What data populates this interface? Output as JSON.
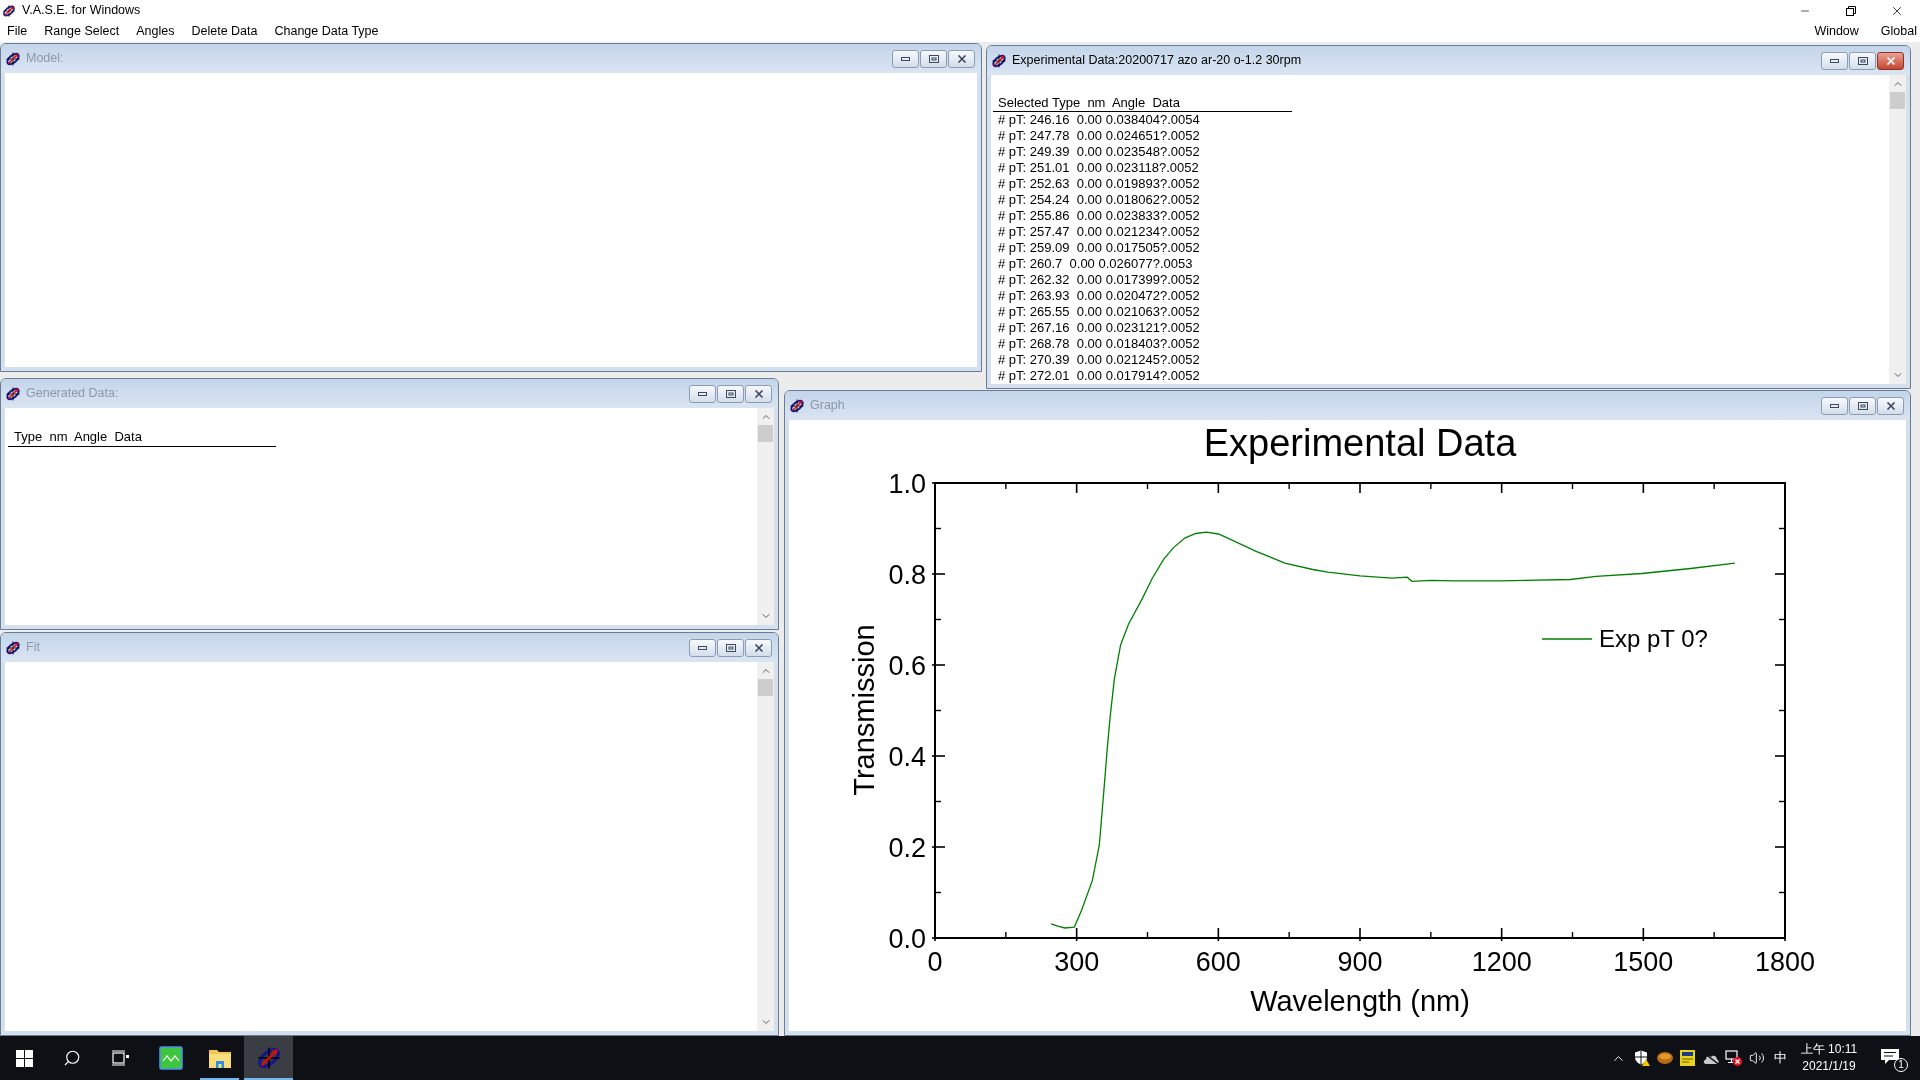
{
  "app": {
    "title": "V.A.S.E. for Windows"
  },
  "menu_bar": {
    "items": [
      "File",
      "Range Select",
      "Angles",
      "Delete Data",
      "Change Data Type"
    ],
    "right_items": [
      "Window",
      "Global"
    ]
  },
  "model_window": {
    "title": "Model:",
    "active": false
  },
  "experimental_data_window": {
    "title": "Experimental Data:20200717 azo ar-20 o-1.2 30rpm",
    "active": true,
    "header": "Selected Type  nm  Angle  Data",
    "rows": [
      "# pT: 246.16  0.00 0.038404?.0054",
      "# pT: 247.78  0.00 0.024651?.0052",
      "# pT: 249.39  0.00 0.023548?.0052",
      "# pT: 251.01  0.00 0.023118?.0052",
      "# pT: 252.63  0.00 0.019893?.0052",
      "# pT: 254.24  0.00 0.018062?.0052",
      "# pT: 255.86  0.00 0.023833?.0052",
      "# pT: 257.47  0.00 0.021234?.0052",
      "# pT: 259.09  0.00 0.017505?.0052",
      "# pT: 260.7  0.00 0.026077?.0053",
      "# pT: 262.32  0.00 0.017399?.0052",
      "# pT: 263.93  0.00 0.020472?.0052",
      "# pT: 265.55  0.00 0.021063?.0052",
      "# pT: 267.16  0.00 0.023121?.0052",
      "# pT: 268.78  0.00 0.018403?.0052",
      "# pT: 270.39  0.00 0.021245?.0052",
      "# pT: 272.01  0.00 0.017914?.0052"
    ]
  },
  "generated_data_window": {
    "title": "Generated Data:",
    "active": false,
    "header": "Type  nm  Angle  Data"
  },
  "fit_window": {
    "title": "Fit",
    "active": false
  },
  "graph_window": {
    "title": "Graph",
    "active": false,
    "chart_data": {
      "type": "line",
      "title": "Experimental Data",
      "xlabel": "Wavelength (nm)",
      "ylabel": "Transmission",
      "x": [
        246,
        260,
        275,
        295,
        310,
        333,
        348,
        358,
        365,
        371,
        380,
        393,
        410,
        439,
        460,
        484,
        505,
        529,
        552,
        575,
        600,
        620,
        680,
        741,
        800,
        832,
        900,
        968,
        1000,
        1010,
        1050,
        1100,
        1195,
        1346,
        1400,
        1497,
        1600,
        1694
      ],
      "series": [
        {
          "name": "Exp pT 0?",
          "color": "#008000",
          "values": [
            0.031,
            0.026,
            0.022,
            0.024,
            0.06,
            0.126,
            0.204,
            0.33,
            0.42,
            0.487,
            0.57,
            0.644,
            0.69,
            0.746,
            0.79,
            0.832,
            0.858,
            0.879,
            0.889,
            0.892,
            0.888,
            0.879,
            0.85,
            0.824,
            0.81,
            0.804,
            0.796,
            0.791,
            0.793,
            0.784,
            0.786,
            0.785,
            0.785,
            0.788,
            0.795,
            0.801,
            0.812,
            0.824
          ]
        }
      ],
      "xlim": [
        0,
        1800
      ],
      "ylim": [
        0,
        1
      ],
      "xticks": [
        0,
        300,
        600,
        900,
        1200,
        1500,
        1800
      ],
      "yticks": [
        {
          "value": 0,
          "label": "0.0"
        },
        {
          "value": 0.2,
          "label": "0.2"
        },
        {
          "value": 0.4,
          "label": "0.4"
        },
        {
          "value": 0.6,
          "label": "0.6"
        },
        {
          "value": 0.8,
          "label": "0.8"
        },
        {
          "value": 1,
          "label": "1.0"
        }
      ]
    }
  },
  "taskbar": {
    "apps": [
      {
        "kind": "chart",
        "running": false,
        "selected": false
      },
      {
        "kind": "folder",
        "running": true,
        "selected": false
      },
      {
        "kind": "logo",
        "running": true,
        "selected": true
      }
    ],
    "tray": {
      "ime": "中",
      "time": "上午 10:11",
      "date": "2021/1/19",
      "notification_count": "1"
    }
  }
}
